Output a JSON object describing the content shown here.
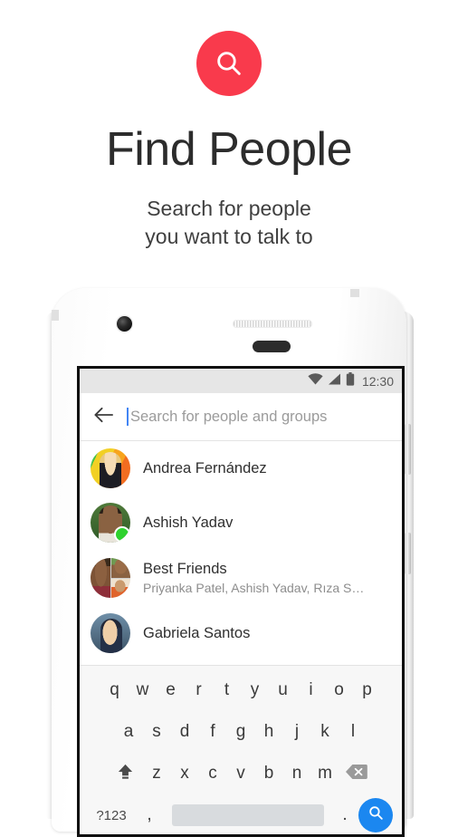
{
  "promo": {
    "logo_icon": "search-icon",
    "logo_color": "#f93a4c",
    "title": "Find People",
    "subtitle_line1": "Search for people",
    "subtitle_line2": "you want to talk to"
  },
  "phone": {
    "statusbar": {
      "wifi_icon": "wifi-icon",
      "signal_icon": "signal-icon",
      "battery_icon": "battery-icon",
      "time": "12:30"
    },
    "searchbar": {
      "back_icon": "back-arrow-icon",
      "placeholder": "Search for people and groups",
      "value": "",
      "cursor_color": "#4285f4"
    },
    "contacts": [
      {
        "name": "Andrea Fernández",
        "subtitle": "",
        "avatar": "av-andrea",
        "online": false
      },
      {
        "name": "Ashish Yadav",
        "subtitle": "",
        "avatar": "av-ashish",
        "online": true
      },
      {
        "name": "Best Friends",
        "subtitle": "Priyanka Patel, Ashish Yadav, Rıza S…",
        "avatar": "av-group",
        "online": false
      },
      {
        "name": "Gabriela Santos",
        "subtitle": "",
        "avatar": "av-gabriela",
        "online": false
      }
    ],
    "keyboard": {
      "row1": [
        "q",
        "w",
        "e",
        "r",
        "t",
        "y",
        "u",
        "i",
        "o",
        "p"
      ],
      "row2": [
        "a",
        "s",
        "d",
        "f",
        "g",
        "h",
        "j",
        "k",
        "l"
      ],
      "row3": [
        "z",
        "x",
        "c",
        "v",
        "b",
        "n",
        "m"
      ],
      "shift_icon": "shift-icon",
      "backspace_icon": "backspace-icon",
      "numeric_label": "?123",
      "comma": ",",
      "period": ".",
      "space_label": "",
      "action_icon": "search-icon",
      "action_color": "#1b87f0"
    }
  }
}
